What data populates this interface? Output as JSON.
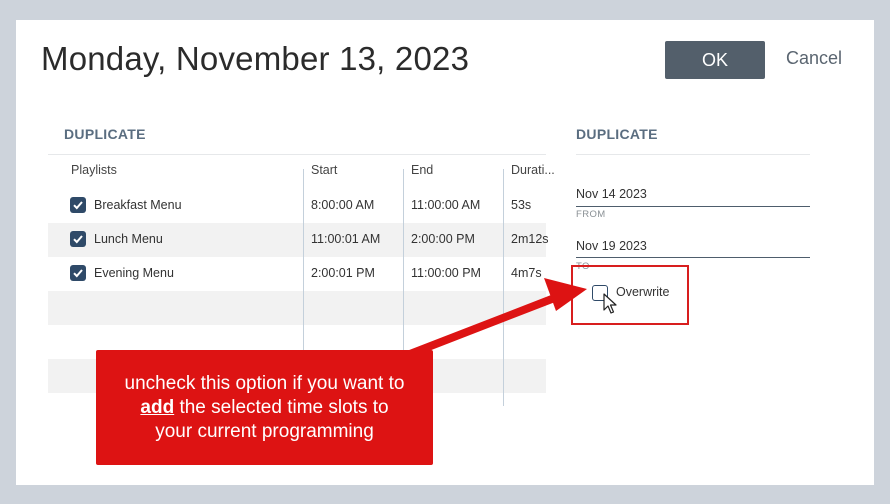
{
  "dialog": {
    "title": "Monday, November 13, 2023",
    "ok_label": "OK",
    "cancel_label": "Cancel"
  },
  "left": {
    "heading": "DUPLICATE",
    "columns": [
      "Playlists",
      "Start",
      "End",
      "Durati..."
    ],
    "rows": [
      {
        "name": "Breakfast Menu",
        "start": "8:00:00 AM",
        "end": "11:00:00 AM",
        "duration": "53s",
        "checked": true
      },
      {
        "name": "Lunch Menu",
        "start": "11:00:01 AM",
        "end": "2:00:00 PM",
        "duration": "2m12s",
        "checked": true
      },
      {
        "name": "Evening Menu",
        "start": "2:00:01 PM",
        "end": "11:00:00 PM",
        "duration": "4m7s",
        "checked": true
      }
    ]
  },
  "right": {
    "heading": "DUPLICATE",
    "from_value": "Nov 14 2023",
    "from_label": "FROM",
    "to_value": "Nov 19 2023",
    "to_label": "TO",
    "overwrite_label": "Overwrite",
    "overwrite_checked": false
  },
  "callout": {
    "line1": "uncheck this option if you want to",
    "emph": "add",
    "line2_rest": " the selected time slots to",
    "line3": "your current programming"
  },
  "colors": {
    "accent": "#535f6b",
    "checkbox": "#2f4a68",
    "annotation_red": "#dd1313"
  }
}
